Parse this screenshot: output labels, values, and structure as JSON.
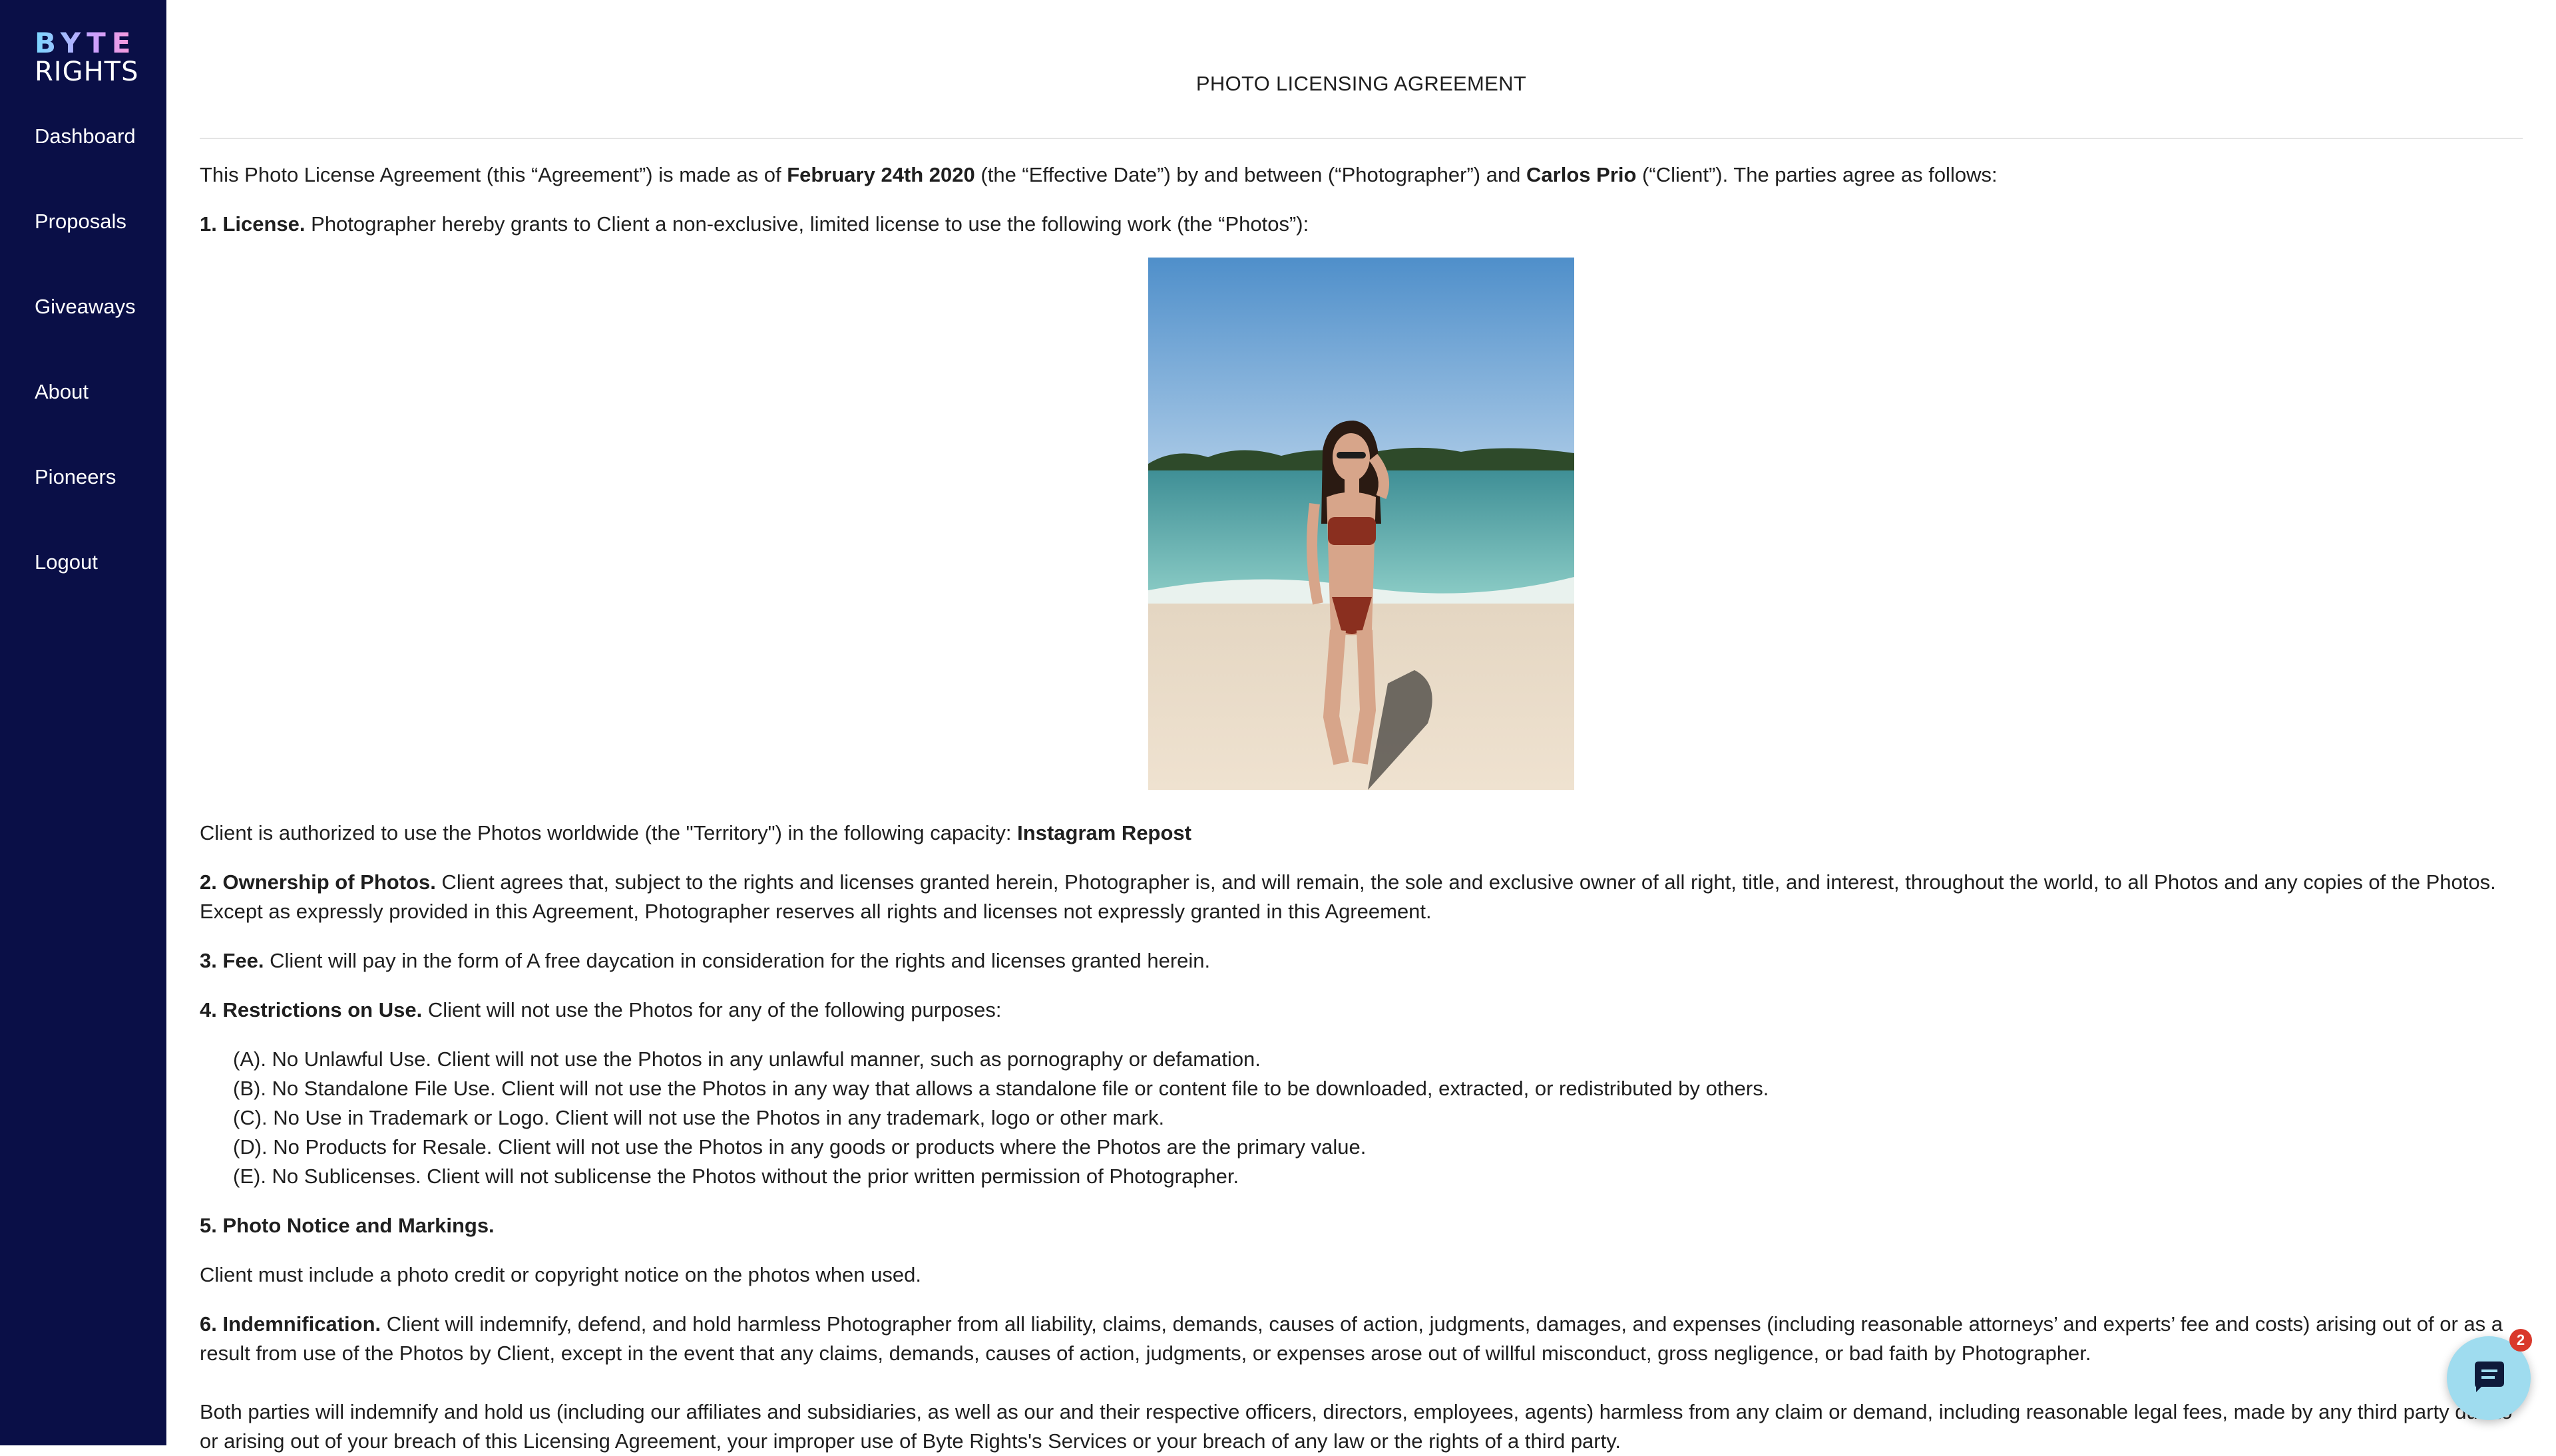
{
  "sidebar": {
    "logo": {
      "line1": "BYTE",
      "line2": "RIGHTS"
    },
    "items": [
      {
        "label": "Dashboard"
      },
      {
        "label": "Proposals"
      },
      {
        "label": "Giveaways"
      },
      {
        "label": "About"
      },
      {
        "label": "Pioneers"
      },
      {
        "label": "Logout"
      }
    ]
  },
  "document": {
    "title": "PHOTO LICENSING AGREEMENT",
    "intro": {
      "a": "This Photo License Agreement (this “Agreement”) is made as of ",
      "date": "February 24th 2020",
      "b": " (the “Effective Date”) by and between (“Photographer”) and ",
      "client": "Carlos Prio",
      "c": " (“Client”). The parties agree as follows:"
    },
    "license": {
      "heading": "1. License.",
      "text": " Photographer hereby grants to Client a non-exclusive, limited license to use the following work (the “Photos”):"
    },
    "territory": {
      "text": "Client is authorized to use the Photos worldwide (the \"Territory\") in the following capacity: ",
      "capacity": "Instagram Repost"
    },
    "ownership": {
      "heading": "2. Ownership of Photos.",
      "text": " Client agrees that, subject to the rights and licenses granted herein, Photographer is, and will remain, the sole and exclusive owner of all right, title, and interest, throughout the world, to all Photos and any copies of the Photos. Except as expressly provided in this Agreement, Photographer reserves all rights and licenses not expressly granted in this Agreement."
    },
    "fee": {
      "heading": "3. Fee.",
      "text": " Client will pay in the form of A free daycation in consideration for the rights and licenses granted herein."
    },
    "restrictions": {
      "heading": "4. Restrictions on Use.",
      "text": " Client will not use the Photos for any of the following purposes:",
      "items": [
        "(A). No Unlawful Use. Client will not use the Photos in any unlawful manner, such as pornography or defamation.",
        "(B). No Standalone File Use. Client will not use the Photos in any way that allows a standalone file or content file to be downloaded, extracted, or redistributed by others.",
        "(C). No Use in Trademark or Logo. Client will not use the Photos in any trademark, logo or other mark.",
        "(D). No Products for Resale. Client will not use the Photos in any goods or products where the Photos are the primary value.",
        "(E). No Sublicenses. Client will not sublicense the Photos without the prior written permission of Photographer."
      ]
    },
    "notice": {
      "heading": "5. Photo Notice and Markings.",
      "text": "Client must include a photo credit or copyright notice on the photos when used."
    },
    "indemnification": {
      "heading": "6. Indemnification.",
      "text": " Client will indemnify, defend, and hold harmless Photographer from all liability, claims, demands, causes of action, judgments, damages, and expenses (including reasonable attorneys’ and experts’ fee and costs) arising out of or as a result from use of the Photos by Client, except in the event that any claims, demands, causes of action, judgments, or expenses arose out of willful misconduct, gross negligence, or bad faith by Photographer."
    },
    "mutual": {
      "text": "Both parties will indemnify and hold us (including our affiliates and subsidiaries, as well as our and their respective officers, directors, employees, agents) harmless from any claim or demand, including reasonable legal fees, made by any third party due to or arising out of your breach of this Licensing Agreement, your improper use of Byte Rights's Services or your breach of any law or the rights of a third party."
    }
  },
  "chat": {
    "badge_count": "2",
    "icon": "chat-bubble-icon"
  },
  "colors": {
    "sidebar_bg": "#0a0f47",
    "chat_bg": "#9fdcef",
    "badge_bg": "#d9382b"
  }
}
